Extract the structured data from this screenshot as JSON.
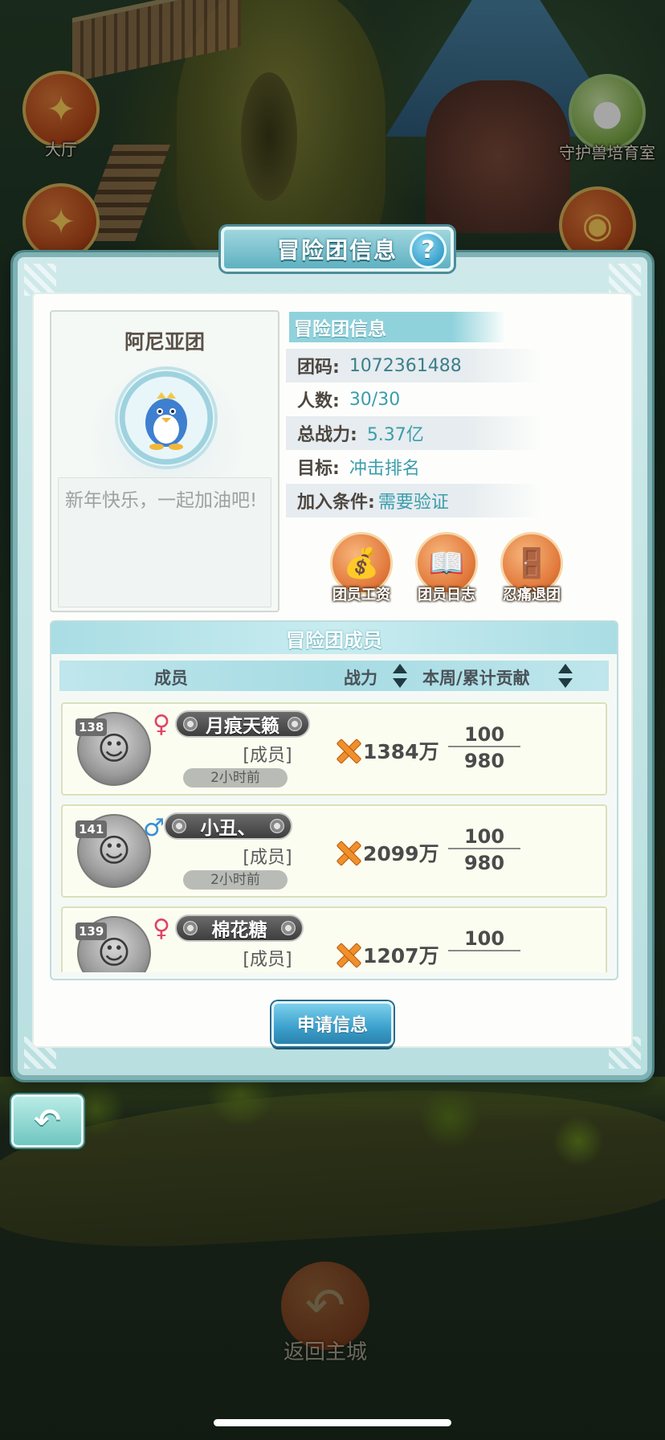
{
  "background": {
    "buttons": [
      {
        "label": "大厅",
        "icon": "maple-leaf-icon"
      },
      {
        "label": "",
        "icon": "maple-leaf-icon"
      },
      {
        "label": "守护兽培育室",
        "icon": "egg-icon"
      },
      {
        "label": "",
        "icon": "monster-icon"
      }
    ],
    "return_city_label": "返回主城"
  },
  "modal": {
    "title": "冒险团信息",
    "help_icon": "?"
  },
  "guild": {
    "name": "阿尼亚团",
    "emblem": "penguin-emblem",
    "motto": "新年快乐，一起加油吧!"
  },
  "info": {
    "header": "冒险团信息",
    "rows": [
      {
        "key": "团码:",
        "value": "1072361488"
      },
      {
        "key": "人数:",
        "value": "30/30"
      },
      {
        "key": "总战力:",
        "value": "5.37亿"
      },
      {
        "key": "目标:",
        "value": "冲击排名"
      },
      {
        "key": "加入条件:",
        "value": "需要验证"
      }
    ]
  },
  "actions": [
    {
      "label": "团员工资",
      "icon": "money-bag-icon"
    },
    {
      "label": "团员日志",
      "icon": "book-icon"
    },
    {
      "label": "忍痛退团",
      "icon": "exit-door-icon"
    }
  ],
  "members": {
    "title": "冒险团成员",
    "columns": {
      "member": "成员",
      "power": "战力",
      "contribution": "本周/累计贡献"
    },
    "rows": [
      {
        "level": "138",
        "gender": "♀",
        "name": "月痕天籁",
        "role": "[成员]",
        "last_seen": "2小时前",
        "power": "1384万",
        "week": "100",
        "total": "980"
      },
      {
        "level": "141",
        "gender": "♂",
        "name": "小丑、",
        "role": "[成员]",
        "last_seen": "2小时前",
        "power": "2099万",
        "week": "100",
        "total": "980"
      },
      {
        "level": "139",
        "gender": "♀",
        "name": "棉花糖",
        "role": "[成员]",
        "last_seen": "",
        "power": "1207万",
        "week": "100",
        "total": ""
      }
    ]
  },
  "apply_button": "申请信息",
  "back_button_icon": "back-arrow-icon",
  "colors": {
    "accent_teal": "#3b9dad",
    "panel_border": "#7fb2b4",
    "action_orange": "#e27a3c",
    "female": "#e04464"
  }
}
